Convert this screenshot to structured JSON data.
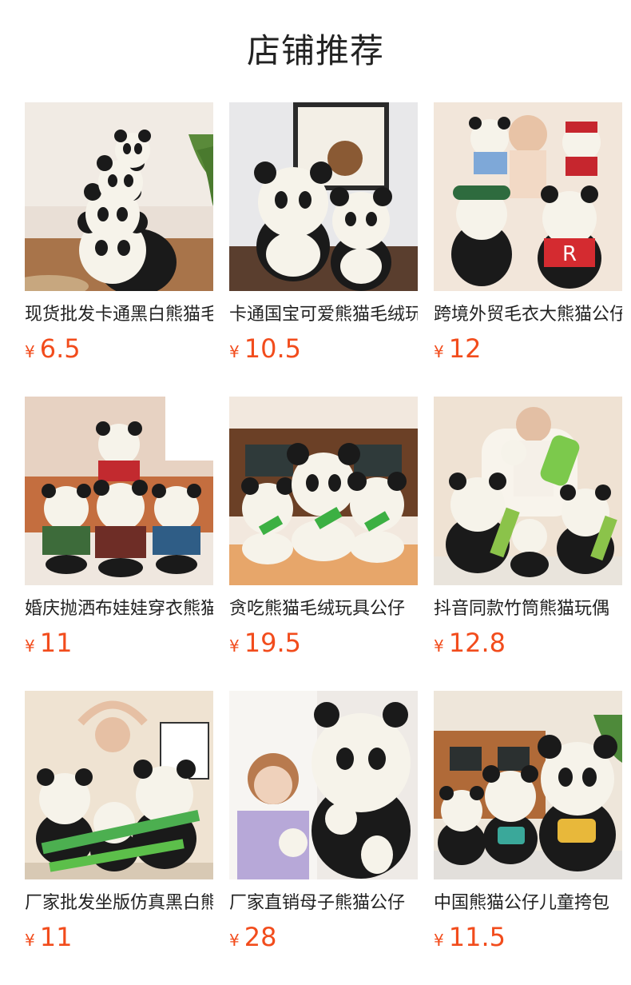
{
  "header": {
    "title": "店铺推荐"
  },
  "currency_symbol": "¥",
  "colors": {
    "price": "#f24c1c",
    "text": "#222222",
    "background": "#ffffff"
  },
  "products": [
    {
      "name": "现货批发卡通黑白熊猫毛绒玩具",
      "price": "6.5"
    },
    {
      "name": "卡通国宝可爱熊猫毛绒玩具公仔",
      "price": "10.5"
    },
    {
      "name": "跨境外贸毛衣大熊猫公仔",
      "price": "12"
    },
    {
      "name": "婚庆抛洒布娃娃穿衣熊猫",
      "price": "11"
    },
    {
      "name": "贪吃熊猫毛绒玩具公仔",
      "price": "19.5"
    },
    {
      "name": "抖音同款竹筒熊猫玩偶",
      "price": "12.8"
    },
    {
      "name": "厂家批发坐版仿真黑白熊猫",
      "price": "11"
    },
    {
      "name": "厂家直销母子熊猫公仔",
      "price": "28"
    },
    {
      "name": "中国熊猫公仔儿童挎包",
      "price": "11.5"
    }
  ]
}
